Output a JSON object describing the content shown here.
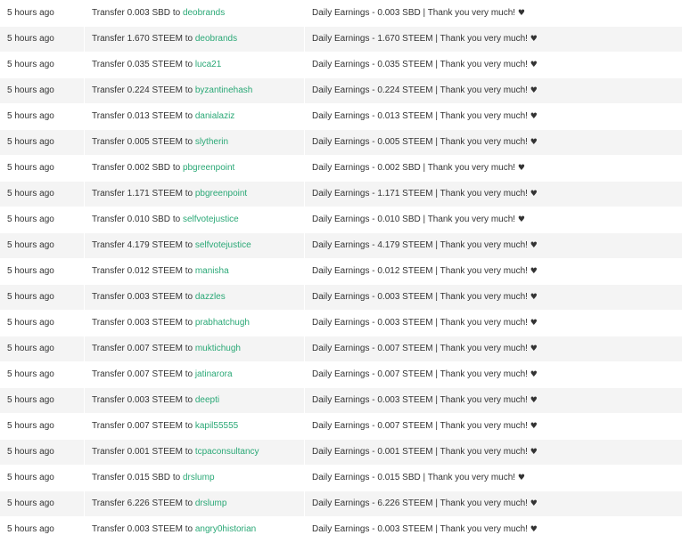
{
  "transfers": [
    {
      "time": "5 hours ago",
      "amount": "0.003 SBD",
      "to": "deobrands",
      "memo": "Daily Earnings - 0.003 SBD | Thank you very much!"
    },
    {
      "time": "5 hours ago",
      "amount": "1.670 STEEM",
      "to": "deobrands",
      "memo": "Daily Earnings - 1.670 STEEM | Thank you very much!"
    },
    {
      "time": "5 hours ago",
      "amount": "0.035 STEEM",
      "to": "luca21",
      "memo": "Daily Earnings - 0.035 STEEM | Thank you very much!"
    },
    {
      "time": "5 hours ago",
      "amount": "0.224 STEEM",
      "to": "byzantinehash",
      "memo": "Daily Earnings - 0.224 STEEM | Thank you very much!"
    },
    {
      "time": "5 hours ago",
      "amount": "0.013 STEEM",
      "to": "danialaziz",
      "memo": "Daily Earnings - 0.013 STEEM | Thank you very much!"
    },
    {
      "time": "5 hours ago",
      "amount": "0.005 STEEM",
      "to": "slytherin",
      "memo": "Daily Earnings - 0.005 STEEM | Thank you very much!"
    },
    {
      "time": "5 hours ago",
      "amount": "0.002 SBD",
      "to": "pbgreenpoint",
      "memo": "Daily Earnings - 0.002 SBD | Thank you very much!"
    },
    {
      "time": "5 hours ago",
      "amount": "1.171 STEEM",
      "to": "pbgreenpoint",
      "memo": "Daily Earnings - 1.171 STEEM | Thank you very much!"
    },
    {
      "time": "5 hours ago",
      "amount": "0.010 SBD",
      "to": "selfvotejustice",
      "memo": "Daily Earnings - 0.010 SBD | Thank you very much!"
    },
    {
      "time": "5 hours ago",
      "amount": "4.179 STEEM",
      "to": "selfvotejustice",
      "memo": "Daily Earnings - 4.179 STEEM | Thank you very much!"
    },
    {
      "time": "5 hours ago",
      "amount": "0.012 STEEM",
      "to": "manisha",
      "memo": "Daily Earnings - 0.012 STEEM | Thank you very much!"
    },
    {
      "time": "5 hours ago",
      "amount": "0.003 STEEM",
      "to": "dazzles",
      "memo": "Daily Earnings - 0.003 STEEM | Thank you very much!"
    },
    {
      "time": "5 hours ago",
      "amount": "0.003 STEEM",
      "to": "prabhatchugh",
      "memo": "Daily Earnings - 0.003 STEEM | Thank you very much!"
    },
    {
      "time": "5 hours ago",
      "amount": "0.007 STEEM",
      "to": "muktichugh",
      "memo": "Daily Earnings - 0.007 STEEM | Thank you very much!"
    },
    {
      "time": "5 hours ago",
      "amount": "0.007 STEEM",
      "to": "jatinarora",
      "memo": "Daily Earnings - 0.007 STEEM | Thank you very much!"
    },
    {
      "time": "5 hours ago",
      "amount": "0.003 STEEM",
      "to": "deepti",
      "memo": "Daily Earnings - 0.003 STEEM | Thank you very much!"
    },
    {
      "time": "5 hours ago",
      "amount": "0.007 STEEM",
      "to": "kapil55555",
      "memo": "Daily Earnings - 0.007 STEEM | Thank you very much!"
    },
    {
      "time": "5 hours ago",
      "amount": "0.001 STEEM",
      "to": "tcpaconsultancy",
      "memo": "Daily Earnings - 0.001 STEEM | Thank you very much!"
    },
    {
      "time": "5 hours ago",
      "amount": "0.015 SBD",
      "to": "drslump",
      "memo": "Daily Earnings - 0.015 SBD | Thank you very much!"
    },
    {
      "time": "5 hours ago",
      "amount": "6.226 STEEM",
      "to": "drslump",
      "memo": "Daily Earnings - 6.226 STEEM | Thank you very much!"
    },
    {
      "time": "5 hours ago",
      "amount": "0.003 STEEM",
      "to": "angry0historian",
      "memo": "Daily Earnings - 0.003 STEEM | Thank you very much!"
    }
  ],
  "labels": {
    "transfer_prefix": "Transfer",
    "to_word": "to",
    "heart_symbol": "♥"
  },
  "colors": {
    "link": "#2aa876",
    "text": "#333333",
    "row_alt": "#f4f4f4"
  }
}
